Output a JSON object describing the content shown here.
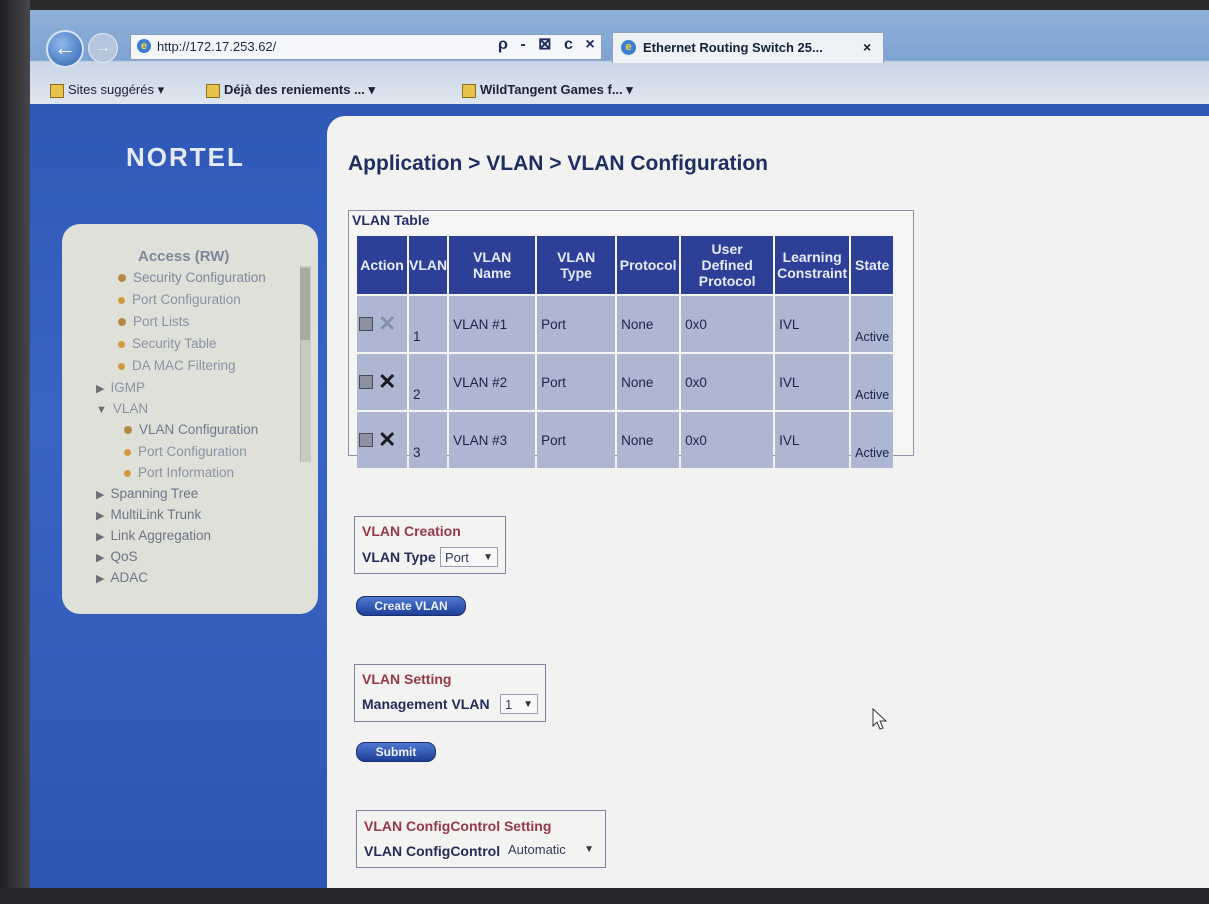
{
  "browser": {
    "address": "http://172.17.253.62/",
    "address_tools": "ρ - ⊠ c ×",
    "tab_title": "Ethernet Routing Switch 25...",
    "tab_close": "×",
    "favorites": [
      {
        "label": "Sites suggérés ▾"
      },
      {
        "label": "Déjà des reniements ... ▾"
      },
      {
        "label": "WildTangent Games f... ▾"
      }
    ]
  },
  "logo": "NORTEL",
  "nav": {
    "header": "Access (RW)",
    "items": [
      {
        "label": "Security Configuration"
      },
      {
        "label": "Port Configuration"
      },
      {
        "label": "Port Lists"
      },
      {
        "label": "Security Table"
      },
      {
        "label": "DA MAC Filtering"
      }
    ],
    "igmp": "IGMP",
    "vlan": "VLAN",
    "vlan_items": [
      {
        "label": "VLAN Configuration"
      },
      {
        "label": "Port Configuration"
      },
      {
        "label": "Port Information"
      }
    ],
    "top_items": [
      {
        "label": "Spanning Tree"
      },
      {
        "label": "MultiLink Trunk"
      },
      {
        "label": "Link Aggregation"
      },
      {
        "label": "QoS"
      },
      {
        "label": "ADAC"
      }
    ]
  },
  "breadcrumb": "Application > VLAN > VLAN Configuration",
  "vlan_table": {
    "title": "VLAN Table",
    "headers": {
      "action": "Action",
      "vlan": "VLAN",
      "vlan_name_1": "VLAN",
      "vlan_name_2": "Name",
      "vlan_type_1": "VLAN",
      "vlan_type_2": "Type",
      "protocol": "Protocol",
      "udp_1": "User",
      "udp_2": "Defined",
      "udp_3": "Protocol",
      "learning_1": "Learning",
      "learning_2": "Constraint",
      "state": "State"
    },
    "rows": [
      {
        "vlan": "1",
        "name": "VLAN #1",
        "type": "Port",
        "protocol": "None",
        "udp": "0x0",
        "learning": "IVL",
        "state": "Active"
      },
      {
        "vlan": "2",
        "name": "VLAN #2",
        "type": "Port",
        "protocol": "None",
        "udp": "0x0",
        "learning": "IVL",
        "state": "Active"
      },
      {
        "vlan": "3",
        "name": "VLAN #3",
        "type": "Port",
        "protocol": "None",
        "udp": "0x0",
        "learning": "IVL",
        "state": "Active"
      }
    ]
  },
  "vlan_creation": {
    "title": "VLAN Creation",
    "type_label": "VLAN Type",
    "type_value": "Port",
    "button": "Create VLAN"
  },
  "vlan_setting": {
    "title": "VLAN Setting",
    "mgmt_label": "Management VLAN",
    "mgmt_value": "1",
    "button": "Submit"
  },
  "vlan_configcontrol": {
    "title": "VLAN ConfigControl Setting",
    "label": "VLAN ConfigControl",
    "value": "Automatic"
  },
  "icons": {
    "ie": "internet-explorer-icon",
    "edit": "edit-icon",
    "delete": "delete-icon"
  },
  "colors": {
    "page_blue": "#2f58b7",
    "header_blue": "#2d3f96",
    "cell_blue": "#aeb7d2",
    "section_title": "#963845"
  }
}
